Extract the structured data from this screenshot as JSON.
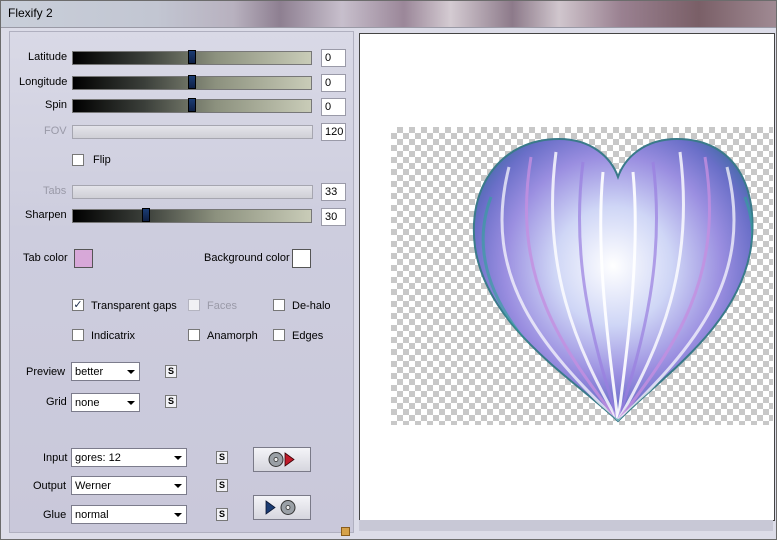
{
  "window": {
    "title": "Flexify 2"
  },
  "controls": {
    "latitude": {
      "label": "Latitude",
      "value": "0",
      "level": 0.5
    },
    "longitude": {
      "label": "Longitude",
      "value": "0",
      "level": 0.5
    },
    "spin": {
      "label": "Spin",
      "value": "0",
      "level": 0.5
    },
    "fov": {
      "label": "FOV",
      "value": "120"
    },
    "flip": {
      "label": "Flip",
      "checked": false
    },
    "tabs": {
      "label": "Tabs",
      "value": "33"
    },
    "sharpen": {
      "label": "Sharpen",
      "value": "30",
      "level": 0.3
    }
  },
  "colors": {
    "tab_color": {
      "label": "Tab color",
      "hex": "#d7a8d8"
    },
    "background_color": {
      "label": "Background color",
      "hex": "#ffffff"
    }
  },
  "options": {
    "transparent_gaps": {
      "label": "Transparent gaps",
      "checked": true
    },
    "faces": {
      "label": "Faces",
      "checked": false
    },
    "de_halo": {
      "label": "De-halo",
      "checked": false
    },
    "indicatrix": {
      "label": "Indicatrix",
      "checked": false
    },
    "anamorph": {
      "label": "Anamorph",
      "checked": false
    },
    "edges": {
      "label": "Edges",
      "checked": false
    }
  },
  "preview": {
    "label": "Preview",
    "value": "better",
    "s_label": "S"
  },
  "grid": {
    "label": "Grid",
    "value": "none",
    "s_label": "S"
  },
  "input": {
    "label": "Input",
    "value": "gores: 12",
    "s_label": "S"
  },
  "output": {
    "label": "Output",
    "value": "Werner",
    "s_label": "S"
  },
  "glue": {
    "label": "Glue",
    "value": "normal",
    "s_label": "S"
  },
  "buttons": {
    "load_icon": "disc-play-icon",
    "save_icon": "play-disc-icon"
  }
}
